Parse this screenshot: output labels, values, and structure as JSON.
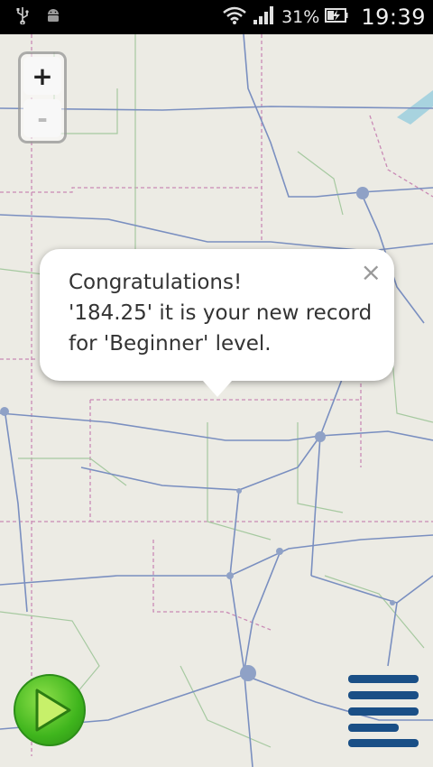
{
  "status_bar": {
    "icons_left": [
      "usb-icon",
      "android-icon"
    ],
    "icons_right": [
      "wifi-icon",
      "signal-icon",
      "battery-icon"
    ],
    "battery_percent": "31%",
    "time": "19:39"
  },
  "map": {
    "zoom_in_label": "+",
    "zoom_out_label": "-",
    "zoom_out_enabled": false
  },
  "popup": {
    "close_label": "×",
    "line1": "Congratulations!",
    "line2": "'184.25' it is your new record",
    "line3": "for 'Beginner' level."
  },
  "controls": {
    "play_icon": "play-icon",
    "menu_icon": "menu-icon"
  },
  "colors": {
    "map_background": "#ecebe4",
    "road": "#7a8fc0",
    "minor_road": "#a6c9a0",
    "border": "#c98ab5",
    "play_green": "#3fb51d",
    "menu_blue": "#1a4f86"
  }
}
